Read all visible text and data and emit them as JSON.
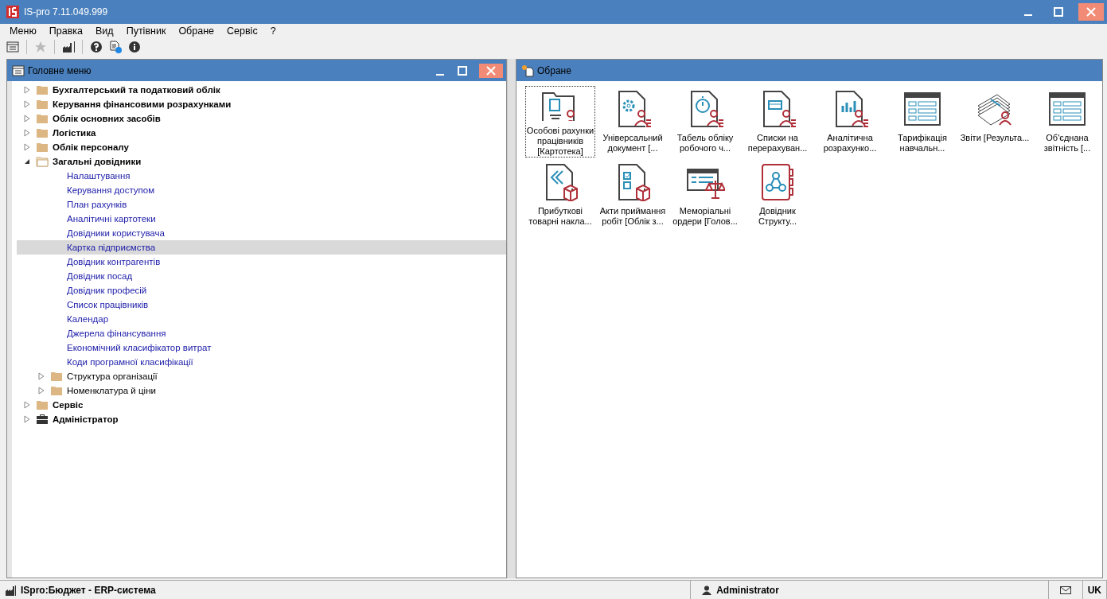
{
  "window": {
    "title": "IS-pro 7.11.049.999"
  },
  "menu": [
    "Меню",
    "Правка",
    "Вид",
    "Путівник",
    "Обране",
    "Сервіс",
    "?"
  ],
  "toolbar": [
    {
      "kind": "list",
      "disabled": false
    },
    {
      "kind": "sep"
    },
    {
      "kind": "star",
      "disabled": true
    },
    {
      "kind": "sep"
    },
    {
      "kind": "factory",
      "disabled": false
    },
    {
      "kind": "sep"
    },
    {
      "kind": "help",
      "disabled": false
    },
    {
      "kind": "doc-help",
      "disabled": false
    },
    {
      "kind": "info",
      "disabled": false
    }
  ],
  "main_menu": {
    "title": "Головне меню",
    "items": [
      {
        "label": "Бухгалтерський та податковий облік",
        "kind": "folder",
        "expanded": false,
        "selected": false
      },
      {
        "label": "Керування фінансовими розрахунками",
        "kind": "folder",
        "expanded": false,
        "selected": false
      },
      {
        "label": "Облік основних засобів",
        "kind": "folder",
        "expanded": false,
        "selected": false
      },
      {
        "label": "Логістика",
        "kind": "folder",
        "expanded": false,
        "selected": false
      },
      {
        "label": "Облік персоналу",
        "kind": "folder",
        "expanded": false,
        "selected": false
      },
      {
        "label": "Загальні довідники",
        "kind": "folder",
        "expanded": true,
        "selected": false,
        "children": [
          {
            "label": "Налаштування",
            "kind": "leaf",
            "selected": false
          },
          {
            "label": "Керування доступом",
            "kind": "leaf",
            "selected": false
          },
          {
            "label": "План рахунків",
            "kind": "leaf",
            "selected": false
          },
          {
            "label": "Аналітичні картотеки",
            "kind": "leaf",
            "selected": false
          },
          {
            "label": "Довідники користувача",
            "kind": "leaf",
            "selected": false
          },
          {
            "label": "Картка підприємства",
            "kind": "leaf",
            "selected": true
          },
          {
            "label": "Довідник контрагентів",
            "kind": "leaf",
            "selected": false
          },
          {
            "label": "Довідник посад",
            "kind": "leaf",
            "selected": false
          },
          {
            "label": "Довідник професій",
            "kind": "leaf",
            "selected": false
          },
          {
            "label": "Список працівників",
            "kind": "leaf",
            "selected": false
          },
          {
            "label": "Календар",
            "kind": "leaf",
            "selected": false
          },
          {
            "label": "Джерела фінансування",
            "kind": "leaf",
            "selected": false
          },
          {
            "label": "Економічний класифікатор витрат",
            "kind": "leaf",
            "selected": false
          },
          {
            "label": "Коди програмної класифікації",
            "kind": "leaf",
            "selected": false
          },
          {
            "label": "Структура організації",
            "kind": "folder",
            "expanded": false,
            "selected": false
          },
          {
            "label": "Номенклатура й ціни",
            "kind": "folder",
            "expanded": false,
            "selected": false
          }
        ]
      },
      {
        "label": "Сервіс",
        "kind": "folder",
        "expanded": false,
        "selected": false
      },
      {
        "label": "Адміністратор",
        "kind": "briefcase",
        "expanded": false,
        "selected": false
      }
    ]
  },
  "favorites": {
    "title": "Обране",
    "items": [
      {
        "label": "Особові рахунки працівників [Картотека]",
        "kind": "person-folder",
        "selected": true
      },
      {
        "label": "Універсальний документ [...",
        "kind": "gear-doc",
        "selected": false
      },
      {
        "label": "Табель обліку робочого ч...",
        "kind": "clock-doc",
        "selected": false
      },
      {
        "label": "Списки на перерахуван...",
        "kind": "card-doc",
        "selected": false
      },
      {
        "label": "Аналітична розрахунко...",
        "kind": "chart-doc",
        "selected": false
      },
      {
        "label": "Тарифікація навчальн...",
        "kind": "table",
        "selected": false
      },
      {
        "label": "Звіти [Результа...",
        "kind": "papers",
        "selected": false
      },
      {
        "label": "Об'єднана звітність [...",
        "kind": "table",
        "selected": false
      },
      {
        "label": "Прибуткові товарні накла...",
        "kind": "arrow-doc",
        "selected": false
      },
      {
        "label": "Акти приймання робіт [Облік з...",
        "kind": "check-doc",
        "selected": false
      },
      {
        "label": "Меморіальні ордери [Голов...",
        "kind": "scales",
        "selected": false
      },
      {
        "label": "Довідник Структу...",
        "kind": "book",
        "selected": false
      }
    ]
  },
  "status_bar": {
    "system": "ISpro:Бюджет - ERP-система",
    "user": "Administrator",
    "language": "UK"
  }
}
